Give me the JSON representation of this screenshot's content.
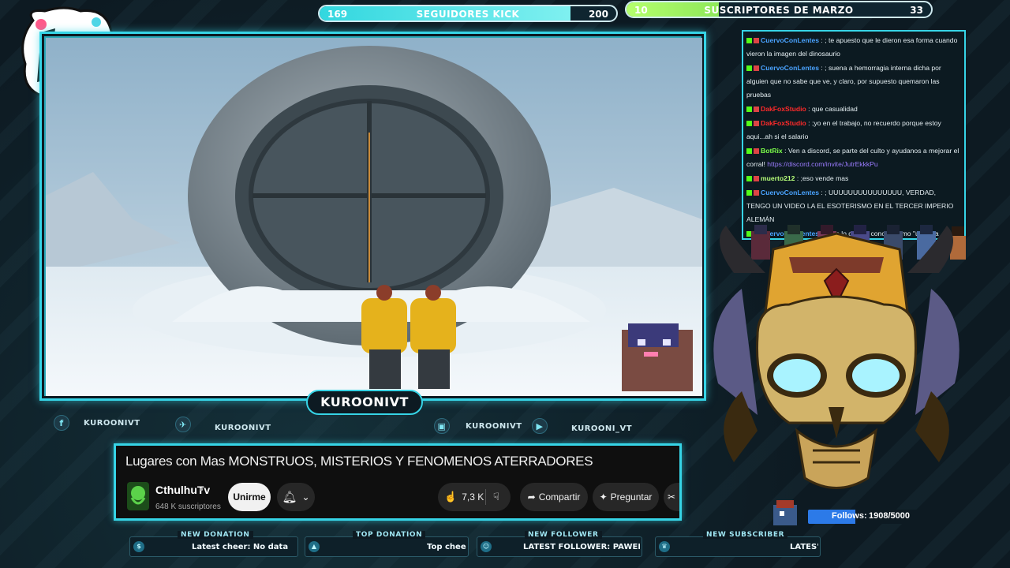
{
  "goals": {
    "kick": {
      "start": "169",
      "title": "SEGUIDORES KICK",
      "end": "200",
      "progress": 0.845
    },
    "subs": {
      "start": "10",
      "title": "SUSCRIPTORES DE MARZO",
      "end": "33",
      "progress": 0.303
    }
  },
  "channel_tag": "KUROONIVT",
  "socials": [
    {
      "icon": "facebook-icon",
      "glyph": "f",
      "label": "KUROONIVT"
    },
    {
      "icon": "twitter-icon",
      "glyph": "✈",
      "label": "KUROONIVT"
    },
    {
      "icon": "instagram-icon",
      "glyph": "▣",
      "label": "KUROONIVT"
    },
    {
      "icon": "youtube-icon",
      "glyph": "▶",
      "label": "KUROONI_VT"
    }
  ],
  "youtube": {
    "title": "Lugares con Mas MONSTRUOS, MISTERIOS Y FENOMENOS ATERRADORES",
    "channel": "CthulhuTv",
    "verified": "●",
    "subscribers": "648 K suscriptores",
    "join": "Unirme",
    "likes": "7,3 K",
    "share": "Compartir",
    "ask": "Preguntar"
  },
  "alerts": [
    {
      "header": "NEW DONATION",
      "text": "Latest cheer: No data"
    },
    {
      "header": "TOP DONATION",
      "text": "Top chee"
    },
    {
      "header": "NEW FOLLOWER",
      "text": "LATEST FOLLOWER: PAWELI"
    },
    {
      "header": "NEW SUBSCRIBER",
      "text": "LATES'"
    }
  ],
  "chat": [
    {
      "user": "CuervoConLentes",
      "color": "#4aa3ff",
      "text": ": ; te apuesto que le dieron esa forma cuando vieron la imagen del dinosaurio"
    },
    {
      "user": "CuervoConLentes",
      "color": "#4aa3ff",
      "text": ": ; suena a hemorragia interna dicha por alguien que no sabe que ve, y claro, por supuesto quemaron las pruebas"
    },
    {
      "user": "DakFoxStudio",
      "color": "#ff2a2a",
      "text": ": que casualidad"
    },
    {
      "user": "DakFoxStudio",
      "color": "#ff2a2a",
      "text": ": ;yo en el trabajo, no recuerdo porque estoy aqui...ah si el salario"
    },
    {
      "user": "BotRix",
      "color": "#7cff4a",
      "text": ": Ven a discord, se parte del culto y ayudanos a mejorar el corral!",
      "link": "https://discord.com/invite/JutrEkkkPu"
    },
    {
      "user": "muerto212",
      "color": "#b7ff7a",
      "text": ": ;eso vende mas"
    },
    {
      "user": "CuervoConLentes",
      "color": "#4aa3ff",
      "text": ": ; UUUUUUUUUUUUUUU, VERDAD, TENGO UN VIDEO LA EL ESOTERISMO EN EL TERCER IMPERIO ALEMÁN"
    },
    {
      "user": "CuervoConLentes",
      "color": "#4aa3ff",
      "text": ": ; son lo que se conoce como \"una isla genética\" al estar aislados de desenrollaron independiente de los cambios pro... es evo... genetica... mo"
    }
  ],
  "follows": {
    "label": "Follows:",
    "value": "1908/5000",
    "progress": 0.3816
  },
  "colors": {
    "accent": "#36d4e6",
    "kick": "#32d7df",
    "subs": "#b5ff6d",
    "follows": "#2c7ae8"
  }
}
